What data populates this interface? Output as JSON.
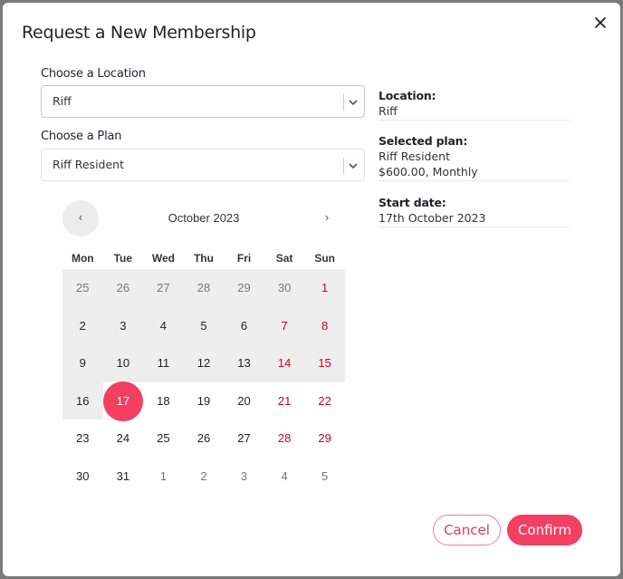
{
  "modal": {
    "title": "Request a New Membership",
    "close_icon": "close-icon"
  },
  "location": {
    "label": "Choose a Location",
    "value": "Riff"
  },
  "plan": {
    "label": "Choose a Plan",
    "value": "Riff Resident"
  },
  "summary": {
    "location_label": "Location:",
    "location_value": "Riff",
    "plan_label": "Selected plan:",
    "plan_name": "Riff Resident",
    "plan_price": "$600.00, Monthly",
    "start_label": "Start date:",
    "start_value": "17th October 2023"
  },
  "calendar": {
    "month": "October 2023",
    "prev_symbol": "‹",
    "next_symbol": "›",
    "weekdays": [
      "Mon",
      "Tue",
      "Wed",
      "Thu",
      "Fri",
      "Sat",
      "Sun"
    ],
    "selected_day": "17",
    "weeks": [
      [
        {
          "d": "25",
          "o": true,
          "r": true
        },
        {
          "d": "26",
          "o": true,
          "r": true
        },
        {
          "d": "27",
          "o": true,
          "r": true
        },
        {
          "d": "28",
          "o": true,
          "r": true
        },
        {
          "d": "29",
          "o": true,
          "r": true
        },
        {
          "d": "30",
          "o": true,
          "r": true
        },
        {
          "d": "1",
          "w": true,
          "r": true
        }
      ],
      [
        {
          "d": "2",
          "r": true
        },
        {
          "d": "3",
          "r": true
        },
        {
          "d": "4",
          "r": true
        },
        {
          "d": "5",
          "r": true
        },
        {
          "d": "6",
          "r": true
        },
        {
          "d": "7",
          "w": true,
          "r": true
        },
        {
          "d": "8",
          "w": true,
          "r": true
        }
      ],
      [
        {
          "d": "9",
          "r": true
        },
        {
          "d": "10",
          "r": true
        },
        {
          "d": "11",
          "r": true
        },
        {
          "d": "12",
          "r": true
        },
        {
          "d": "13",
          "r": true
        },
        {
          "d": "14",
          "w": true,
          "r": true
        },
        {
          "d": "15",
          "w": true,
          "r": true
        }
      ],
      [
        {
          "d": "16",
          "r": true
        },
        {
          "d": "17",
          "s": true
        },
        {
          "d": "18"
        },
        {
          "d": "19"
        },
        {
          "d": "20"
        },
        {
          "d": "21",
          "w": true
        },
        {
          "d": "22",
          "w": true
        }
      ],
      [
        {
          "d": "23"
        },
        {
          "d": "24"
        },
        {
          "d": "25"
        },
        {
          "d": "26"
        },
        {
          "d": "27"
        },
        {
          "d": "28",
          "w": true
        },
        {
          "d": "29",
          "w": true
        }
      ],
      [
        {
          "d": "30"
        },
        {
          "d": "31"
        },
        {
          "d": "1",
          "o": true
        },
        {
          "d": "2",
          "o": true
        },
        {
          "d": "3",
          "o": true
        },
        {
          "d": "4",
          "o": true
        },
        {
          "d": "5",
          "o": true
        }
      ]
    ]
  },
  "actions": {
    "cancel_label": "Cancel",
    "confirm_label": "Confirm"
  },
  "colors": {
    "accent": "#f23f62",
    "weekend": "#d0021b",
    "range_bg": "#eeeeee"
  }
}
